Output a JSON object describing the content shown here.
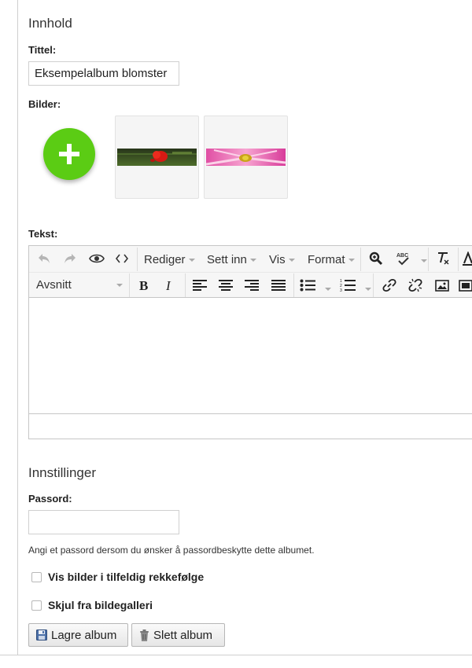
{
  "content_section": {
    "heading": "Innhold",
    "title_label": "Tittel:",
    "title_value": "Eksempelalbum blomster",
    "images_label": "Bilder:",
    "images": [
      {
        "icon": "red-poppy-photo"
      },
      {
        "icon": "pink-daisy-photo"
      }
    ],
    "text_label": "Tekst:"
  },
  "editor": {
    "menus": [
      "Rediger",
      "Sett inn",
      "Vis",
      "Format"
    ],
    "block_format": "Avsnitt"
  },
  "settings_section": {
    "heading": "Innstillinger",
    "password_label": "Passord:",
    "password_value": "",
    "password_help": "Angi et passord dersom du ønsker å passordbeskytte dette albumet.",
    "options": [
      {
        "label": "Vis bilder i tilfeldig rekkefølge",
        "checked": false
      },
      {
        "label": "Skjul fra bildegalleri",
        "checked": false
      }
    ]
  },
  "actions": {
    "save_label": "Lagre album",
    "delete_label": "Slett album"
  },
  "colors": {
    "add_button": "#5bcc14",
    "toolbar_bg": "#f6f6f6",
    "border": "#c6c6c6"
  }
}
